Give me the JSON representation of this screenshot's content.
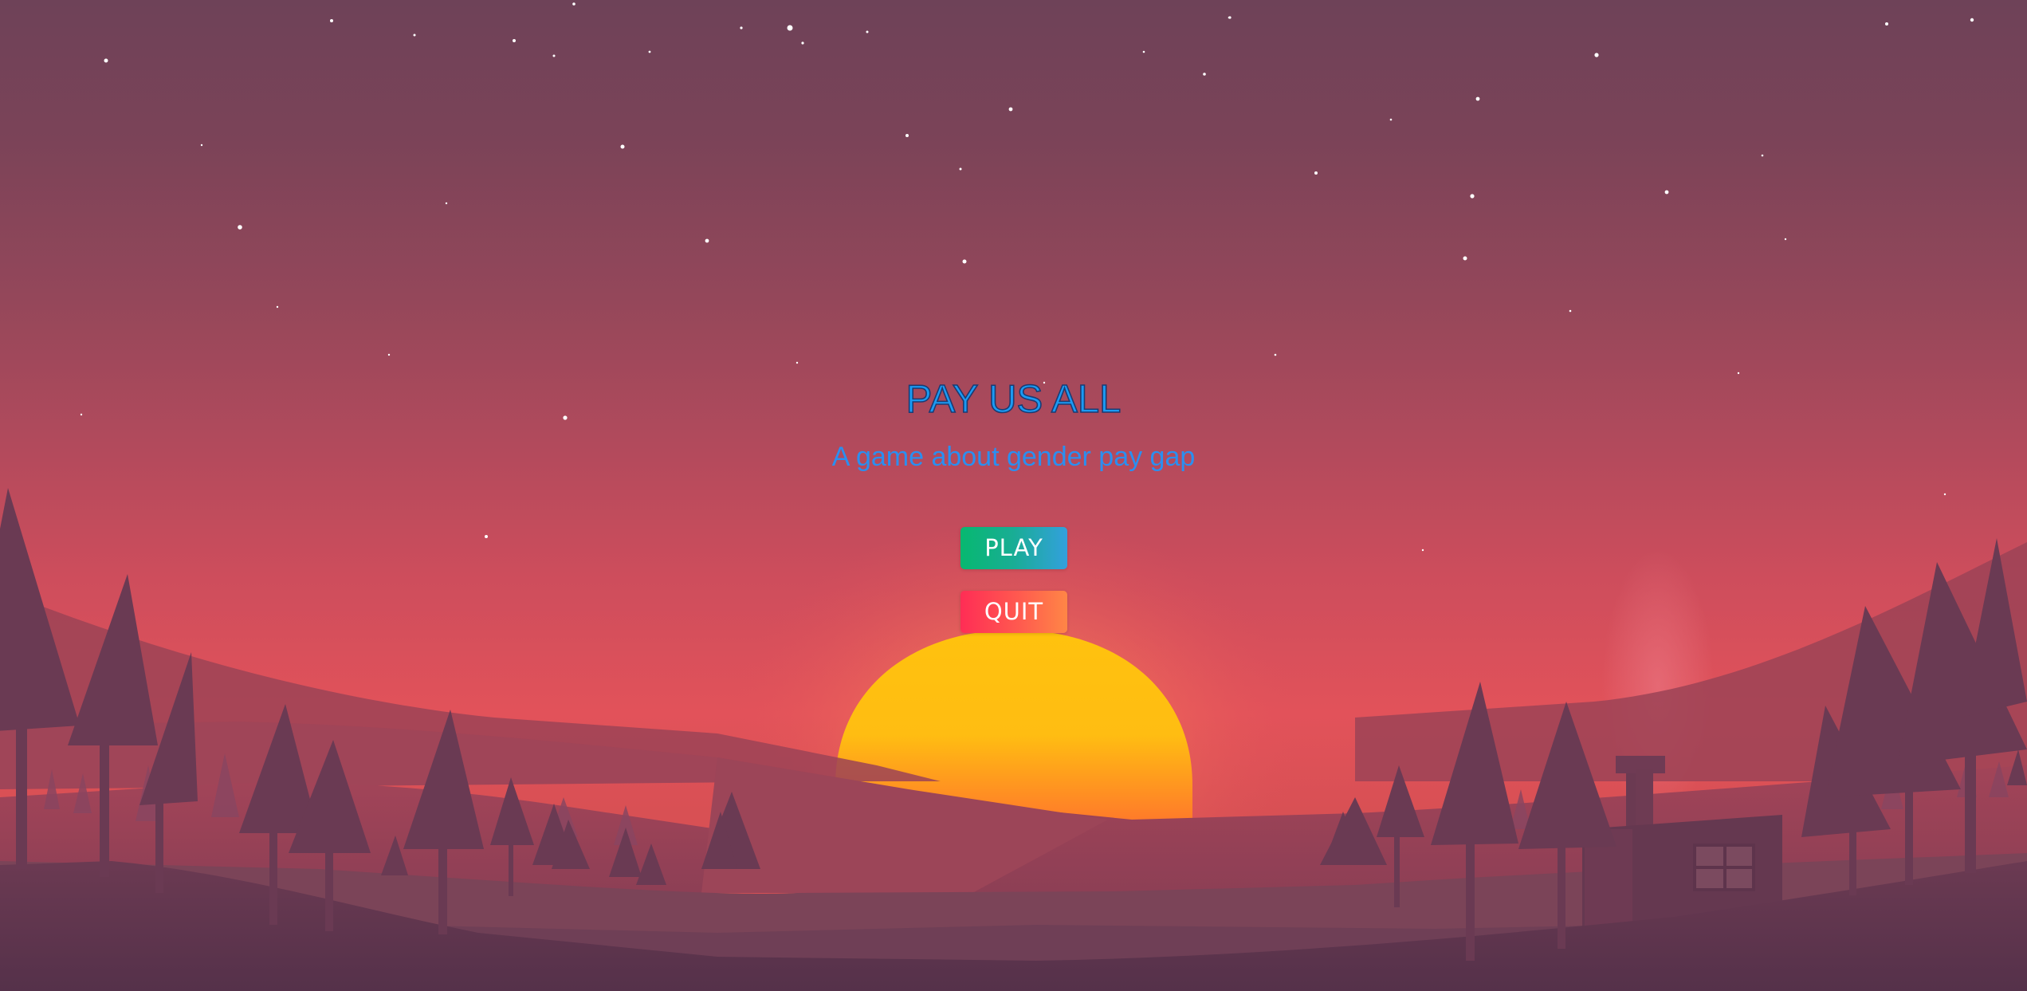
{
  "menu": {
    "title": "PAY US ALL",
    "subtitle": "A game about gender pay gap",
    "play_label": "PLAY",
    "quit_label": "QUIT"
  },
  "colors": {
    "title": "#1b9af3",
    "title_outline": "#1a3b73",
    "subtitle": "#2a8ff0",
    "play_gradient": [
      "#07b870",
      "#33a0dd"
    ],
    "quit_gradient": [
      "#ff2d55",
      "#ff8646"
    ],
    "sun": "#ffc20e",
    "sky_top": "#6e4258",
    "sky_horizon": "#e2525a"
  },
  "scene": {
    "background": "sunset-forest-landscape",
    "elements": [
      "starry-sky",
      "setting-sun",
      "hills",
      "pine-trees",
      "cabin-with-chimney",
      "chimney-smoke"
    ]
  }
}
